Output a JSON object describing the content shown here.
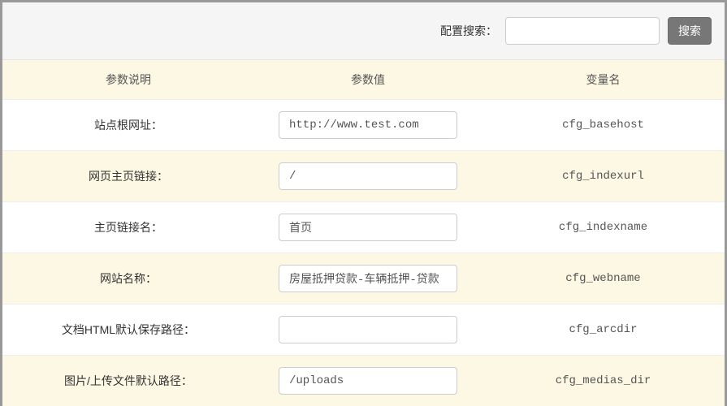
{
  "toolbar": {
    "label": "配置搜索：",
    "search_value": "",
    "search_placeholder": "",
    "button_label": "搜索"
  },
  "table": {
    "headers": {
      "desc": "参数说明",
      "value": "参数值",
      "var": "变量名"
    },
    "rows": [
      {
        "desc": "站点根网址：",
        "value": "http://www.test.com",
        "var": "cfg_basehost"
      },
      {
        "desc": "网页主页链接：",
        "value": "/",
        "var": "cfg_indexurl"
      },
      {
        "desc": "主页链接名：",
        "value": "首页",
        "var": "cfg_indexname"
      },
      {
        "desc": "网站名称：",
        "value": "房屋抵押贷款-车辆抵押-贷款",
        "var": "cfg_webname"
      },
      {
        "desc": "文档HTML默认保存路径：",
        "value": "",
        "var": "cfg_arcdir"
      },
      {
        "desc": "图片/上传文件默认路径：",
        "value": "/uploads",
        "var": "cfg_medias_dir"
      }
    ]
  }
}
